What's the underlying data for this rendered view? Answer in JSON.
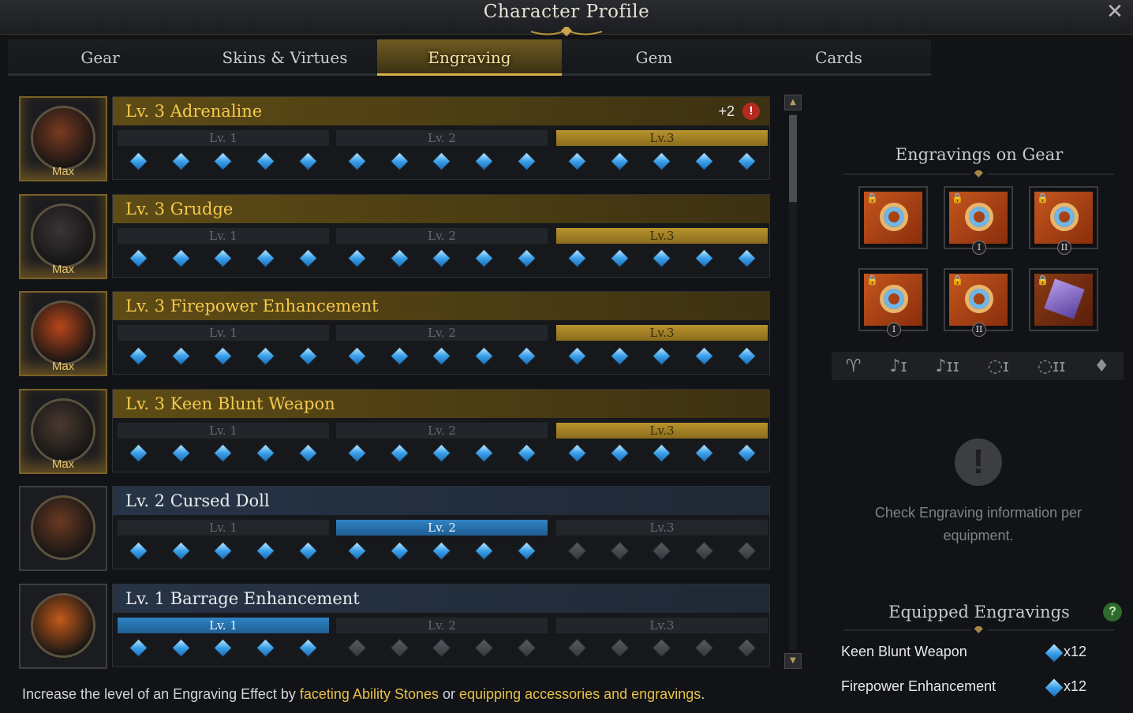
{
  "window": {
    "title": "Character Profile",
    "close_glyph": "✕"
  },
  "tabs": [
    {
      "label": "Gear",
      "active": false
    },
    {
      "label": "Skins & Virtues",
      "active": false
    },
    {
      "label": "Engraving",
      "active": true
    },
    {
      "label": "Gem",
      "active": false
    },
    {
      "label": "Cards",
      "active": false
    }
  ],
  "engravings": [
    {
      "name": "Lv. 3 Adrenaline",
      "style": "gold",
      "max_label": "Max",
      "bonus": "+2",
      "alert": "!",
      "icon": "adrenaline-icon",
      "levels": [
        "Lv. 1",
        "Lv. 2",
        "Lv.3"
      ],
      "active_level": 3,
      "nodes_filled": 15
    },
    {
      "name": "Lv. 3 Grudge",
      "style": "gold",
      "max_label": "Max",
      "icon": "grudge-icon",
      "levels": [
        "Lv. 1",
        "Lv. 2",
        "Lv.3"
      ],
      "active_level": 3,
      "nodes_filled": 15
    },
    {
      "name": "Lv. 3 Firepower Enhancement",
      "style": "gold",
      "max_label": "Max",
      "icon": "firepower-enhancement-icon",
      "levels": [
        "Lv. 1",
        "Lv. 2",
        "Lv.3"
      ],
      "active_level": 3,
      "nodes_filled": 15
    },
    {
      "name": "Lv. 3 Keen Blunt Weapon",
      "style": "gold",
      "max_label": "Max",
      "icon": "keen-blunt-weapon-icon",
      "levels": [
        "Lv. 1",
        "Lv. 2",
        "Lv.3"
      ],
      "active_level": 3,
      "nodes_filled": 15
    },
    {
      "name": "Lv. 2 Cursed Doll",
      "style": "blue",
      "max_label": "",
      "icon": "cursed-doll-icon",
      "levels": [
        "Lv. 1",
        "Lv. 2",
        "Lv.3"
      ],
      "active_level": 2,
      "nodes_filled": 10
    },
    {
      "name": "Lv. 1 Barrage Enhancement",
      "style": "blue",
      "max_label": "",
      "icon": "barrage-enhancement-icon",
      "levels": [
        "Lv. 1",
        "Lv. 2",
        "Lv.3"
      ],
      "active_level": 1,
      "nodes_filled": 5
    }
  ],
  "footer": {
    "prefix": "Increase the level of an Engraving Effect by ",
    "link1": "faceting Ability Stones",
    "middle": " or ",
    "link2": "equipping accessories and engravings",
    "suffix": "."
  },
  "sidebar": {
    "gear_title": "Engravings on Gear",
    "gear_slots": [
      {
        "icon": "necklace-icon",
        "sub": ""
      },
      {
        "icon": "earring-icon",
        "sub": "I"
      },
      {
        "icon": "earring-icon",
        "sub": "II"
      },
      {
        "icon": "ring-icon",
        "sub": "I"
      },
      {
        "icon": "ring-icon",
        "sub": "II"
      },
      {
        "icon": "ability-stone-icon",
        "sub": ""
      }
    ],
    "slot_filters": [
      {
        "icon": "necklace-filter-icon",
        "glyph": "♈"
      },
      {
        "icon": "earring-1-filter-icon",
        "glyph": "♪ɪ"
      },
      {
        "icon": "earring-2-filter-icon",
        "glyph": "♪ɪɪ"
      },
      {
        "icon": "ring-1-filter-icon",
        "glyph": "◌ɪ"
      },
      {
        "icon": "ring-2-filter-icon",
        "glyph": "◌ɪɪ"
      },
      {
        "icon": "stone-filter-icon",
        "glyph": "♦"
      }
    ],
    "info_glyph": "!",
    "info_text": "Check Engraving information per equipment.",
    "equipped_title": "Equipped Engravings",
    "help_glyph": "?",
    "equipped": [
      {
        "name": "Keen Blunt Weapon",
        "count": "x12"
      },
      {
        "name": "Firepower Enhancement",
        "count": "x12"
      }
    ]
  },
  "colors": {
    "gold": "#f5c94b",
    "accent_blue": "#3aa0ea",
    "tab_active": "#6f5a20"
  }
}
